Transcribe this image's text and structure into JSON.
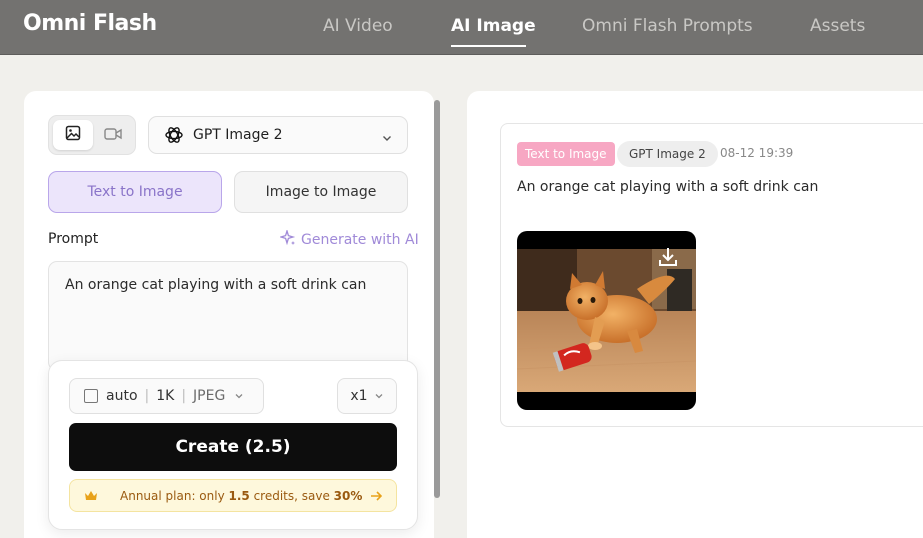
{
  "header": {
    "logo": "Omni Flash",
    "nav": [
      {
        "label": "AI Video",
        "active": false
      },
      {
        "label": "AI Image",
        "active": true
      },
      {
        "label": "Omni Flash Prompts",
        "active": false
      },
      {
        "label": "Assets",
        "active": false
      }
    ]
  },
  "generator": {
    "mode_icons": [
      "image-icon",
      "video-camera-icon"
    ],
    "model": {
      "label": "GPT Image 2",
      "icon": "openai-logo-icon"
    },
    "tabs": [
      {
        "label": "Text to Image",
        "active": true
      },
      {
        "label": "Image to Image",
        "active": false
      }
    ],
    "prompt_label": "Prompt",
    "generate_ai_label": "Generate with AI",
    "prompt_text": "An orange cat playing with a soft drink can",
    "options": {
      "aspect": "auto",
      "resolution": "1K",
      "format": "JPEG",
      "count": "x1"
    },
    "create_label": "Create (2.5)",
    "promo": {
      "prefix": "Annual plan: only ",
      "credits": "1.5",
      "middle": " credits, save ",
      "discount": "30%"
    }
  },
  "result": {
    "type_badge": "Text to Image",
    "model_badge": "GPT Image 2",
    "timestamp": "08-12 19:39",
    "prompt": "An orange cat playing with a soft drink can"
  },
  "colors": {
    "header_bg": "#737270",
    "accent_purple": "#8a74c9",
    "badge_pink": "#f7a7c3",
    "promo_bg": "#fef8dc",
    "create_bg": "#0d0d0d"
  }
}
